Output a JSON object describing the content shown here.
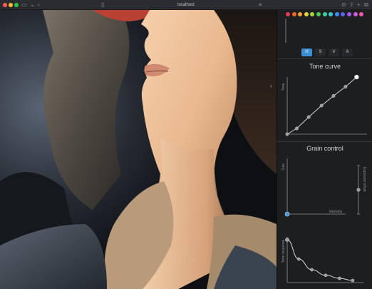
{
  "browser": {
    "url": "localhost",
    "icons": [
      "sidebar-icon",
      "chevron-left-icon",
      "chevron-right-icon",
      "shield-icon",
      "reader-icon",
      "download-icon",
      "share-icon",
      "plus-icon",
      "tabs-icon"
    ]
  },
  "palette": {
    "swatches": [
      "#e8384f",
      "#f06a2e",
      "#f2a33a",
      "#e8d23a",
      "#a6d83a",
      "#4ccd5a",
      "#3ed1a0",
      "#3ac5d8",
      "#3a8ff0",
      "#5a62f0",
      "#9a5af0",
      "#d65ae0",
      "#f05aa8"
    ]
  },
  "modes": {
    "buttons": [
      {
        "label": "H",
        "active": true
      },
      {
        "label": "S",
        "active": false
      },
      {
        "label": "V",
        "active": false
      },
      {
        "label": "A",
        "active": false
      }
    ]
  },
  "tone_curve": {
    "title": "Tone curve",
    "ylabel": "Tone",
    "points": [
      [
        0,
        0
      ],
      [
        0.12,
        0.1
      ],
      [
        0.27,
        0.3
      ],
      [
        0.43,
        0.5
      ],
      [
        0.58,
        0.67
      ],
      [
        0.73,
        0.83
      ],
      [
        0.87,
        1.0
      ]
    ]
  },
  "grain": {
    "title": "Grain control",
    "ylabel": "Size",
    "xlabel": "Intensity",
    "side_label": "Exposure offset",
    "xy_handle": [
      0,
      0
    ],
    "offset_value": 0.5
  },
  "response": {
    "ylabel": "Tone response",
    "points": [
      [
        0,
        1.0
      ],
      [
        0.15,
        0.55
      ],
      [
        0.32,
        0.3
      ],
      [
        0.5,
        0.17
      ],
      [
        0.68,
        0.1
      ],
      [
        0.85,
        0.05
      ]
    ]
  },
  "accent": "#3d8fd6",
  "collapse_icon": "chevron-right-icon"
}
